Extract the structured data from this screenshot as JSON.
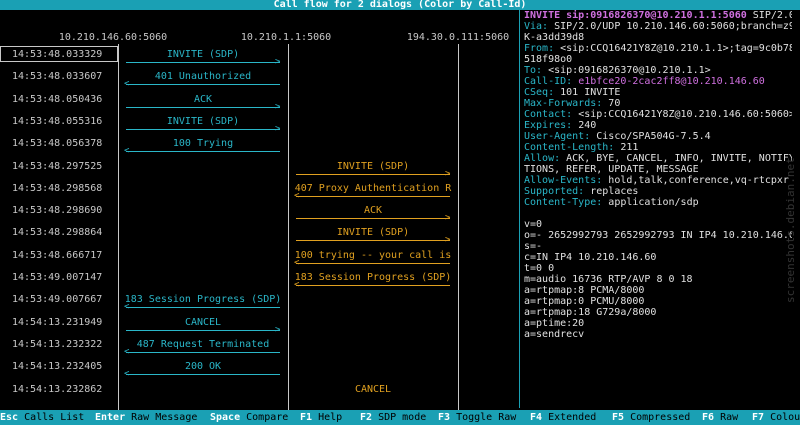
{
  "title": "Call flow for 2 dialogs (Color by Call-Id)",
  "columns": [
    "10.210.146.60:5060",
    "10.210.1.1:5060",
    "194.30.0.111:5060"
  ],
  "flow": [
    {
      "time": "14:53:48.033329",
      "label": "INVITE (SDP)",
      "dir": "right",
      "span": "ab",
      "color": "#2ab6c8",
      "selected": true
    },
    {
      "time": "14:53:48.033607",
      "label": "401 Unauthorized",
      "dir": "left",
      "span": "ab",
      "color": "#2ab6c8"
    },
    {
      "time": "14:53:48.050436",
      "label": "ACK",
      "dir": "right",
      "span": "ab",
      "color": "#2ab6c8"
    },
    {
      "time": "14:53:48.055316",
      "label": "INVITE (SDP)",
      "dir": "right",
      "span": "ab",
      "color": "#2ab6c8"
    },
    {
      "time": "14:53:48.056378",
      "label": "100 Trying",
      "dir": "left",
      "span": "ab",
      "color": "#2ab6c8"
    },
    {
      "time": "14:53:48.297525",
      "label": "INVITE (SDP)",
      "dir": "right",
      "span": "bc",
      "color": "#e0a020"
    },
    {
      "time": "14:53:48.298568",
      "label": "407 Proxy Authentication R",
      "dir": "left",
      "span": "bc",
      "color": "#e0a020"
    },
    {
      "time": "14:53:48.298690",
      "label": "ACK",
      "dir": "right",
      "span": "bc",
      "color": "#e0a020"
    },
    {
      "time": "14:53:48.298864",
      "label": "INVITE (SDP)",
      "dir": "right",
      "span": "bc",
      "color": "#e0a020"
    },
    {
      "time": "14:53:48.666717",
      "label": "100 trying -- your call is",
      "dir": "left",
      "span": "bc",
      "color": "#e0a020"
    },
    {
      "time": "14:53:49.007147",
      "label": "183 Session Progress (SDP)",
      "dir": "left",
      "span": "bc",
      "color": "#e0a020"
    },
    {
      "time": "14:53:49.007667",
      "label": "183 Session Progress (SDP)",
      "dir": "left",
      "span": "ab",
      "color": "#2ab6c8"
    },
    {
      "time": "14:54:13.231949",
      "label": "CANCEL",
      "dir": "right",
      "span": "ab",
      "color": "#2ab6c8"
    },
    {
      "time": "14:54:13.232322",
      "label": "487 Request Terminated",
      "dir": "left",
      "span": "ab",
      "color": "#2ab6c8"
    },
    {
      "time": "14:54:13.232405",
      "label": "200 OK",
      "dir": "left",
      "span": "ab",
      "color": "#2ab6c8"
    },
    {
      "time": "14:54:13.232862",
      "label": "CANCEL",
      "dir": "right",
      "span": "bc",
      "color": "#e0a020",
      "no_arrow": true
    }
  ],
  "detail": [
    {
      "type": "first",
      "text": "INVITE sip:0916826370@10.210.1.1:5060",
      "rest": " SIP/2.0"
    },
    {
      "type": "kv",
      "key": "Via",
      "val": " SIP/2.0/UDP 10.210.146.60:5060;branch=z9hG"
    },
    {
      "type": "plain",
      "text": "K-a3dd39d8"
    },
    {
      "type": "kv",
      "key": "From",
      "val": " <sip:CCQ16421Y8Z@10.210.1.1>;tag=9c0b7800"
    },
    {
      "type": "plain",
      "text": "518f98o0"
    },
    {
      "type": "kv",
      "key": "To",
      "val": " <sip:0916826370@10.210.1.1>"
    },
    {
      "type": "kvhi",
      "key": "Call-ID",
      "val": " e1bfce20-2cac2ff8@10.210.146.60"
    },
    {
      "type": "kv",
      "key": "CSeq",
      "val": " 101 INVITE"
    },
    {
      "type": "kv",
      "key": "Max-Forwards",
      "val": " 70"
    },
    {
      "type": "kv",
      "key": "Contact",
      "val": " <sip:CCQ16421Y8Z@10.210.146.60:5060>"
    },
    {
      "type": "kv",
      "key": "Expires",
      "val": " 240"
    },
    {
      "type": "kv",
      "key": "User-Agent",
      "val": " Cisco/SPA504G-7.5.4"
    },
    {
      "type": "kv",
      "key": "Content-Length",
      "val": " 211"
    },
    {
      "type": "kv",
      "key": "Allow",
      "val": " ACK, BYE, CANCEL, INFO, INVITE, NOTIFY,"
    },
    {
      "type": "plain",
      "text": "TIONS, REFER, UPDATE, MESSAGE"
    },
    {
      "type": "kv",
      "key": "Allow-Events",
      "val": " hold,talk,conference,vq-rtcpxr"
    },
    {
      "type": "kv",
      "key": "Supported",
      "val": " replaces"
    },
    {
      "type": "kv",
      "key": "Content-Type",
      "val": " application/sdp"
    },
    {
      "type": "plain",
      "text": ""
    },
    {
      "type": "plain",
      "text": "v=0"
    },
    {
      "type": "plain",
      "text": "o=- 2652992793 2652992793 IN IP4 10.210.146.60"
    },
    {
      "type": "plain",
      "text": "s=-"
    },
    {
      "type": "plain",
      "text": "c=IN IP4 10.210.146.60"
    },
    {
      "type": "plain",
      "text": "t=0 0"
    },
    {
      "type": "plain",
      "text": "m=audio 16736 RTP/AVP 8 0 18"
    },
    {
      "type": "plain",
      "text": "a=rtpmap:8 PCMA/8000"
    },
    {
      "type": "plain",
      "text": "a=rtpmap:0 PCMU/8000"
    },
    {
      "type": "plain",
      "text": "a=rtpmap:18 G729a/8000"
    },
    {
      "type": "plain",
      "text": "a=ptime:20"
    },
    {
      "type": "plain",
      "text": "a=sendrecv"
    }
  ],
  "watermark": "screenshots.debian.net",
  "footer": [
    {
      "key": "Esc",
      "action": "Calls List"
    },
    {
      "key": "Enter",
      "action": "Raw Message"
    },
    {
      "key": "Space",
      "action": "Compare"
    },
    {
      "key": "F1",
      "action": "Help"
    },
    {
      "key": "F2",
      "action": "SDP mode"
    },
    {
      "key": "F3",
      "action": "Toggle Raw"
    },
    {
      "key": "F4",
      "action": "Extended"
    },
    {
      "key": "F5",
      "action": "Compressed"
    },
    {
      "key": "F6",
      "action": "Raw"
    },
    {
      "key": "F7",
      "action": "Colour"
    }
  ]
}
